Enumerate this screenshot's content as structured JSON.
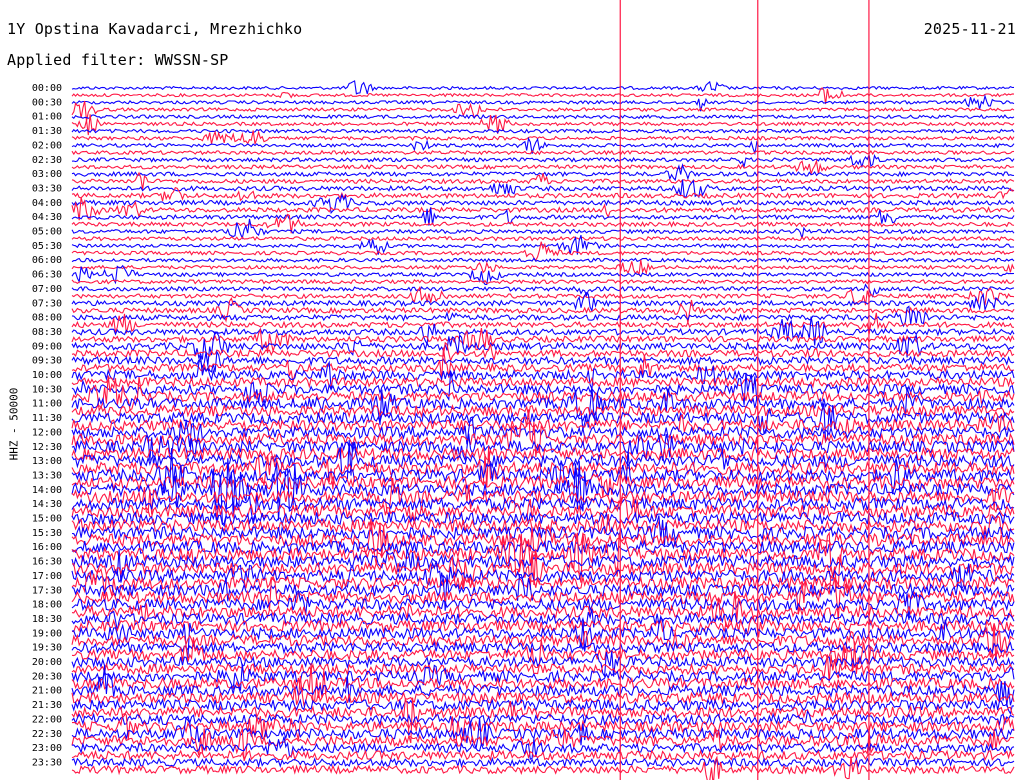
{
  "header": {
    "station": "1Y Opstina Kavadarci, Mrezhichko",
    "date": "2025-11-21",
    "filter": "Applied filter: WWSSN-SP"
  },
  "chart_data": {
    "type": "line",
    "description_kind": "helicorder",
    "ylabel": "HHZ - 50000",
    "row_labels": [
      "00:00",
      "00:30",
      "01:00",
      "01:30",
      "02:00",
      "02:30",
      "03:00",
      "03:30",
      "04:00",
      "04:30",
      "05:00",
      "05:30",
      "06:00",
      "06:30",
      "07:00",
      "07:30",
      "08:00",
      "08:30",
      "09:00",
      "09:30",
      "10:00",
      "10:30",
      "11:00",
      "11:30",
      "12:00",
      "12:30",
      "13:00",
      "13:30",
      "14:00",
      "14:30",
      "15:00",
      "15:30",
      "16:00",
      "16:30",
      "17:00",
      "17:30",
      "18:00",
      "18:30",
      "19:00",
      "19:30",
      "20:00",
      "20:30",
      "21:00",
      "21:30",
      "22:00",
      "22:30",
      "23:00",
      "23:30"
    ],
    "colors": [
      "#0a00ff",
      "#ff1744"
    ],
    "traces_per_row": 2,
    "noise_by_hour": [
      0.35,
      0.38,
      0.4,
      0.42,
      0.42,
      0.45,
      0.5,
      0.55,
      0.55,
      0.5,
      0.45,
      0.42,
      0.42,
      0.45,
      0.5,
      0.6,
      0.65,
      0.7,
      0.8,
      0.9,
      1.05,
      1.15,
      1.25,
      1.3,
      1.35,
      1.4,
      1.45,
      1.45,
      1.45,
      1.45,
      1.45,
      1.45,
      1.45,
      1.45,
      1.4,
      1.4,
      1.35,
      1.3,
      1.25,
      1.2,
      1.2,
      1.25,
      1.25,
      1.25,
      1.2,
      1.2,
      1.05,
      0.9
    ],
    "tall_spikes_x_fraction": [
      0.582,
      0.728,
      0.846
    ]
  }
}
